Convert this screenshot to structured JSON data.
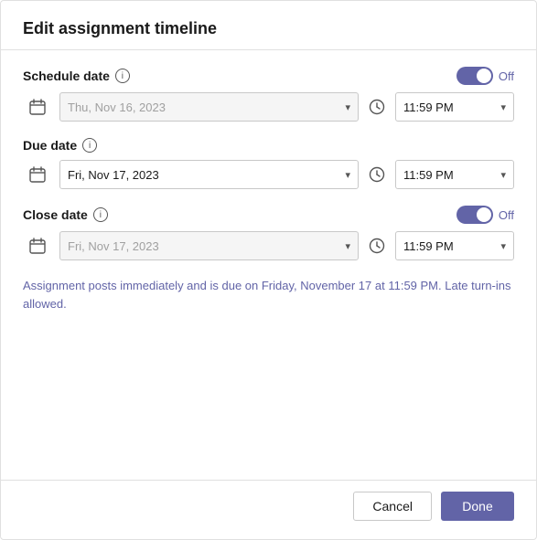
{
  "header": {
    "title": "Edit assignment timeline"
  },
  "schedule_date": {
    "label": "Schedule date",
    "toggle_label": "Off",
    "date_placeholder": "Thu, Nov 16, 2023",
    "time_value": "11:59 PM",
    "enabled": false
  },
  "due_date": {
    "label": "Due date",
    "date_value": "Fri, Nov 17, 2023",
    "time_value": "11:59 PM",
    "enabled": true
  },
  "close_date": {
    "label": "Close date",
    "toggle_label": "Off",
    "date_placeholder": "Fri, Nov 17, 2023",
    "time_value": "11:59 PM",
    "enabled": false
  },
  "info_message": "Assignment posts immediately and is due on Friday, November 17 at 11:59 PM. Late turn-ins allowed.",
  "footer": {
    "cancel_label": "Cancel",
    "done_label": "Done"
  }
}
